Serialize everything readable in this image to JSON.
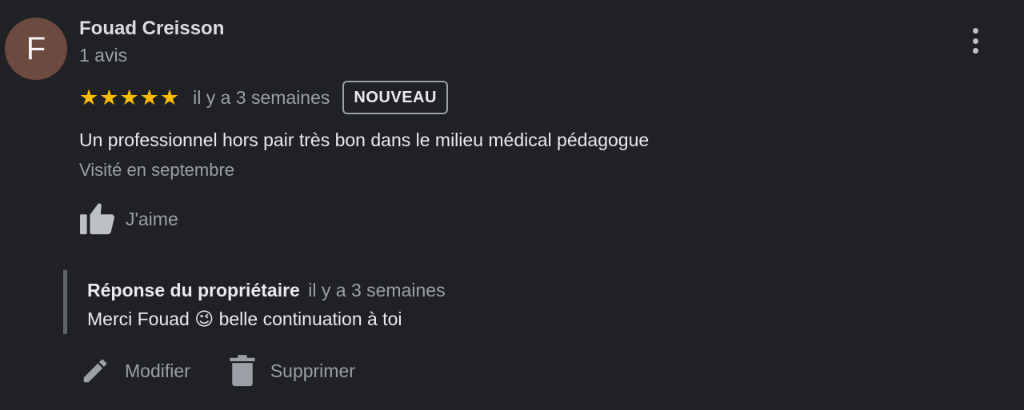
{
  "review": {
    "avatar_initial": "F",
    "author_name": "Fouad Creisson",
    "review_count": "1 avis",
    "rating": 5,
    "rating_max": 5,
    "time_ago": "il y a 3 semaines",
    "badge": "NOUVEAU",
    "text": "Un professionnel hors pair très bon dans le milieu médical pédagogue",
    "visited": "Visité en septembre",
    "like_label": "J'aime",
    "more_icon": "more-vert-icon"
  },
  "owner_reply": {
    "title": "Réponse du propriétaire",
    "time_ago": "il y a 3 semaines",
    "text": "Merci Fouad 😉 belle continuation à toi"
  },
  "actions": {
    "edit_label": "Modifier",
    "delete_label": "Supprimer"
  },
  "colors": {
    "background": "#202124",
    "avatar": "#6b4a40",
    "star": "#fbbc04",
    "secondary_text": "#9aa0a6",
    "icon": "#bdc1c6"
  }
}
